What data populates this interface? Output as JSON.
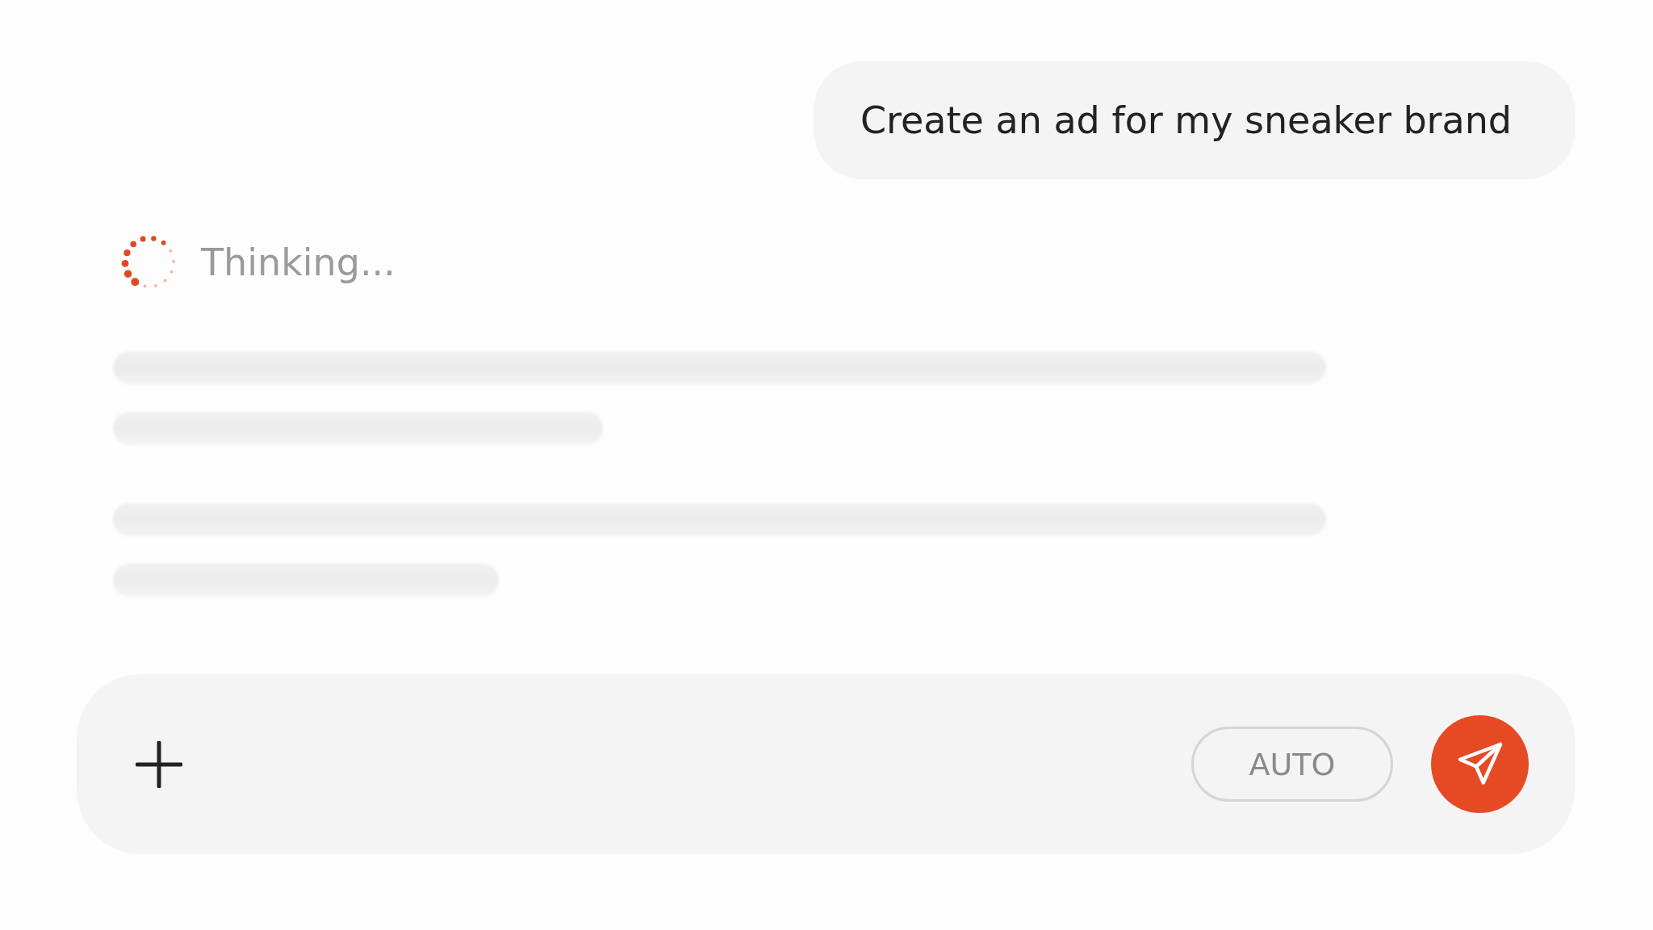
{
  "user_message": {
    "text": "Create an ad for my sneaker brand"
  },
  "assistant": {
    "status": "Thinking..."
  },
  "composer": {
    "mode_button": "AUTO"
  }
}
